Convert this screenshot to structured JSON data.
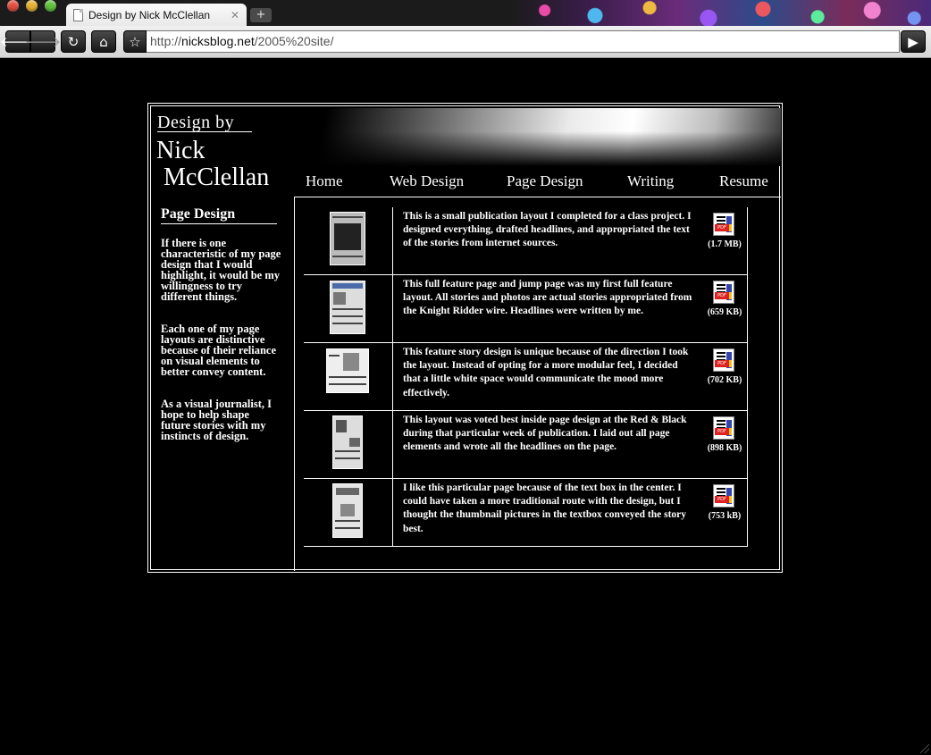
{
  "browser": {
    "tab_title": "Design by Nick McClellan",
    "tab_close": "✕",
    "new_tab": "+",
    "url_prefix": "http://",
    "url_host": "nicksblog.net",
    "url_path": "/2005%20site/",
    "icons": [
      "back-arrow-icon",
      "forward-arrow-icon",
      "reload-icon",
      "home-icon",
      "star-icon",
      "go-arrow-icon"
    ]
  },
  "site": {
    "logo_line1": "Design by",
    "logo_line2": "Nick",
    "logo_line3": "McClellan",
    "nav": [
      "Home",
      "Web Design",
      "Page Design",
      "Writing",
      "Resume"
    ],
    "sidebar": {
      "heading": "Page Design",
      "paragraphs": [
        "If there is one characteristic of my page design that I would highlight, it would be my willingness to try different things.",
        "Each one of my page layouts are distinctive because of their reliance on visual elements to better convey content.",
        "As a visual journalist, I hope to help shape future stories with my instincts of design."
      ]
    },
    "items": [
      {
        "description": "This is a small publication layout I completed for a class project. I designed everything, drafted headlines, and appropriated the text of the stories from internet sources.",
        "pdf_size": "(1.7 MB)"
      },
      {
        "description": "This full feature page and jump page was my first full feature layout. All stories and photos are actual stories appropriated from the Knight Ridder wire. Headlines were written by me.",
        "pdf_size": "(659 KB)"
      },
      {
        "description": "This feature story design is unique because of the direction I took the layout. Instead of opting for a more modular feel, I decided that a little white space would communicate the mood more effectively.",
        "pdf_size": "(702 KB)"
      },
      {
        "description": "This layout was voted best inside page design at the Red & Black during that particular week of publication. I laid out all page elements and wrote all the headlines on the page.",
        "pdf_size": "(898 KB)"
      },
      {
        "description": "I like this particular page because of the text box in the center. I could have taken a more traditional route with the design, but I thought the thumbnail pictures in the textbox conveyed the story best.",
        "pdf_size": "(753 kB)"
      }
    ],
    "pdf_badge": "PDF"
  }
}
